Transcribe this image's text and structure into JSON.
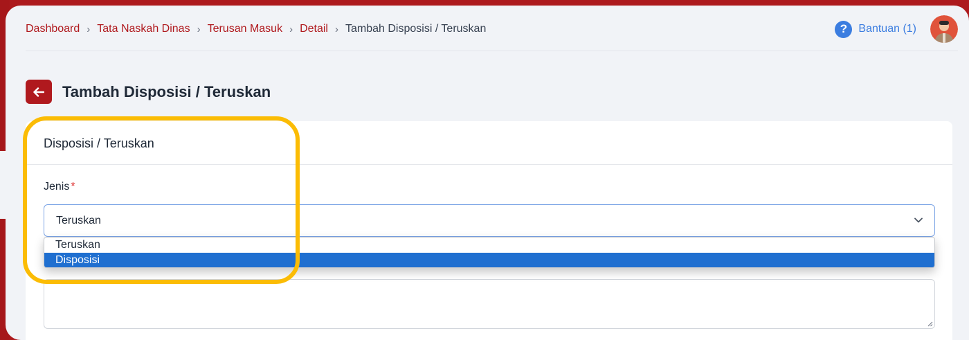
{
  "breadcrumb": {
    "items": [
      "Dashboard",
      "Tata Naskah Dinas",
      "Terusan Masuk",
      "Detail"
    ],
    "current": "Tambah Disposisi / Teruskan",
    "separator": "›"
  },
  "header": {
    "help_label": "Bantuan (1)",
    "help_icon": "question-circle-icon",
    "help_icon_glyph": "?"
  },
  "page": {
    "title": "Tambah Disposisi / Teruskan",
    "back_icon": "arrow-left-icon"
  },
  "card": {
    "title": "Disposisi / Teruskan",
    "field_label": "Jenis",
    "required_mark": "*",
    "select_value": "Teruskan",
    "options": [
      "Teruskan",
      "Disposisi"
    ],
    "highlighted_option": "Disposisi"
  },
  "colors": {
    "brand_red": "#b0191e",
    "link_blue": "#3b7de0",
    "option_highlight": "#1f6fd0",
    "annotation_yellow": "#fbbc05"
  }
}
